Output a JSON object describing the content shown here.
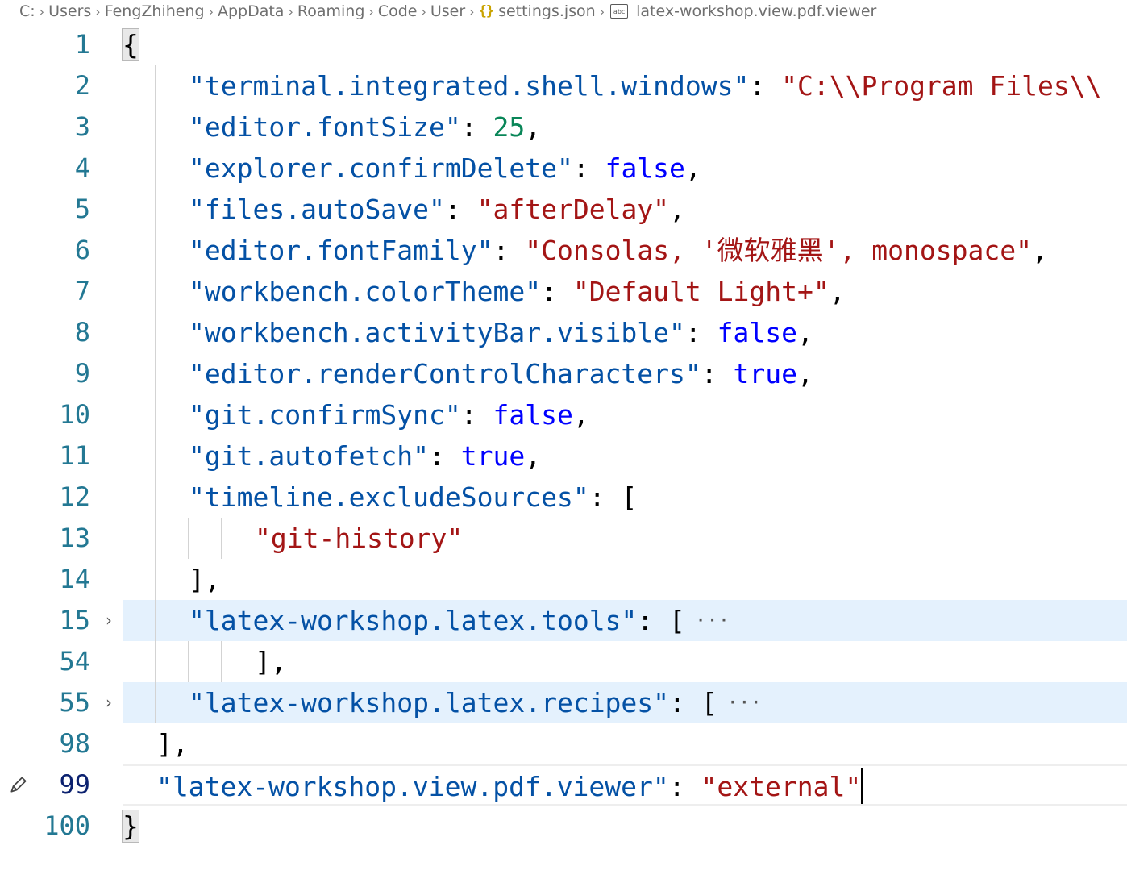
{
  "breadcrumb": {
    "items": [
      "C:",
      "Users",
      "FengZhiheng",
      "AppData",
      "Roaming",
      "Code",
      "User"
    ],
    "file_icon": "{}",
    "file": "settings.json",
    "symbol_icon": "abc",
    "symbol": "latex-workshop.view.pdf.viewer"
  },
  "editor": {
    "lines": [
      {
        "n": "1",
        "tokens": [
          [
            "p",
            "{"
          ]
        ]
      },
      {
        "n": "2",
        "tokens": [
          [
            "k",
            "\"terminal.integrated.shell.windows\""
          ],
          [
            "p",
            ": "
          ],
          [
            "s",
            "\"C:\\\\Program Files\\\\"
          ]
        ]
      },
      {
        "n": "3",
        "tokens": [
          [
            "k",
            "\"editor.fontSize\""
          ],
          [
            "p",
            ": "
          ],
          [
            "n",
            "25"
          ],
          [
            "p",
            ","
          ]
        ]
      },
      {
        "n": "4",
        "tokens": [
          [
            "k",
            "\"explorer.confirmDelete\""
          ],
          [
            "p",
            ": "
          ],
          [
            "b",
            "false"
          ],
          [
            "p",
            ","
          ]
        ]
      },
      {
        "n": "5",
        "tokens": [
          [
            "k",
            "\"files.autoSave\""
          ],
          [
            "p",
            ": "
          ],
          [
            "s",
            "\"afterDelay\""
          ],
          [
            "p",
            ","
          ]
        ]
      },
      {
        "n": "6",
        "tokens": [
          [
            "k",
            "\"editor.fontFamily\""
          ],
          [
            "p",
            ": "
          ],
          [
            "s",
            "\"Consolas, '微软雅黑', monospace\""
          ],
          [
            "p",
            ","
          ]
        ]
      },
      {
        "n": "7",
        "tokens": [
          [
            "k",
            "\"workbench.colorTheme\""
          ],
          [
            "p",
            ": "
          ],
          [
            "s",
            "\"Default Light+\""
          ],
          [
            "p",
            ","
          ]
        ]
      },
      {
        "n": "8",
        "tokens": [
          [
            "k",
            "\"workbench.activityBar.visible\""
          ],
          [
            "p",
            ": "
          ],
          [
            "b",
            "false"
          ],
          [
            "p",
            ","
          ]
        ]
      },
      {
        "n": "9",
        "tokens": [
          [
            "k",
            "\"editor.renderControlCharacters\""
          ],
          [
            "p",
            ": "
          ],
          [
            "b",
            "true"
          ],
          [
            "p",
            ","
          ]
        ]
      },
      {
        "n": "10",
        "tokens": [
          [
            "k",
            "\"git.confirmSync\""
          ],
          [
            "p",
            ": "
          ],
          [
            "b",
            "false"
          ],
          [
            "p",
            ","
          ]
        ]
      },
      {
        "n": "11",
        "tokens": [
          [
            "k",
            "\"git.autofetch\""
          ],
          [
            "p",
            ": "
          ],
          [
            "b",
            "true"
          ],
          [
            "p",
            ","
          ]
        ]
      },
      {
        "n": "12",
        "tokens": [
          [
            "k",
            "\"timeline.excludeSources\""
          ],
          [
            "p",
            ": ["
          ]
        ]
      },
      {
        "n": "13",
        "tokens": [
          [
            "s",
            "\"git-history\""
          ]
        ]
      },
      {
        "n": "14",
        "tokens": [
          [
            "p",
            "],"
          ]
        ]
      },
      {
        "n": "15",
        "tokens": [
          [
            "k",
            "\"latex-workshop.latex.tools\""
          ],
          [
            "p",
            ": ["
          ]
        ],
        "folded": true,
        "ellipsis": "···"
      },
      {
        "n": "54",
        "tokens": [
          [
            "p",
            "],"
          ]
        ]
      },
      {
        "n": "55",
        "tokens": [
          [
            "k",
            "\"latex-workshop.latex.recipes\""
          ],
          [
            "p",
            ": ["
          ]
        ],
        "folded": true,
        "ellipsis": "···"
      },
      {
        "n": "98",
        "tokens": [
          [
            "p",
            "],"
          ]
        ]
      },
      {
        "n": "99",
        "tokens": [
          [
            "k",
            "\"latex-workshop.view.pdf.viewer\""
          ],
          [
            "p",
            ": "
          ],
          [
            "s",
            "\"external\""
          ]
        ],
        "current": true
      },
      {
        "n": "100",
        "tokens": [
          [
            "p",
            "}"
          ]
        ]
      }
    ]
  },
  "colors": {
    "property_key": "#0451a5",
    "string_value": "#a31515",
    "number_value": "#098658",
    "boolean_value": "#0000ff",
    "line_number": "#237893",
    "folded_highlight": "#e4f1fd"
  },
  "icons": {
    "fold_collapsed": "chevron-right-icon",
    "modified_line": "pencil-icon",
    "file_type": "json-braces-icon",
    "symbol_type": "string-symbol-icon"
  }
}
